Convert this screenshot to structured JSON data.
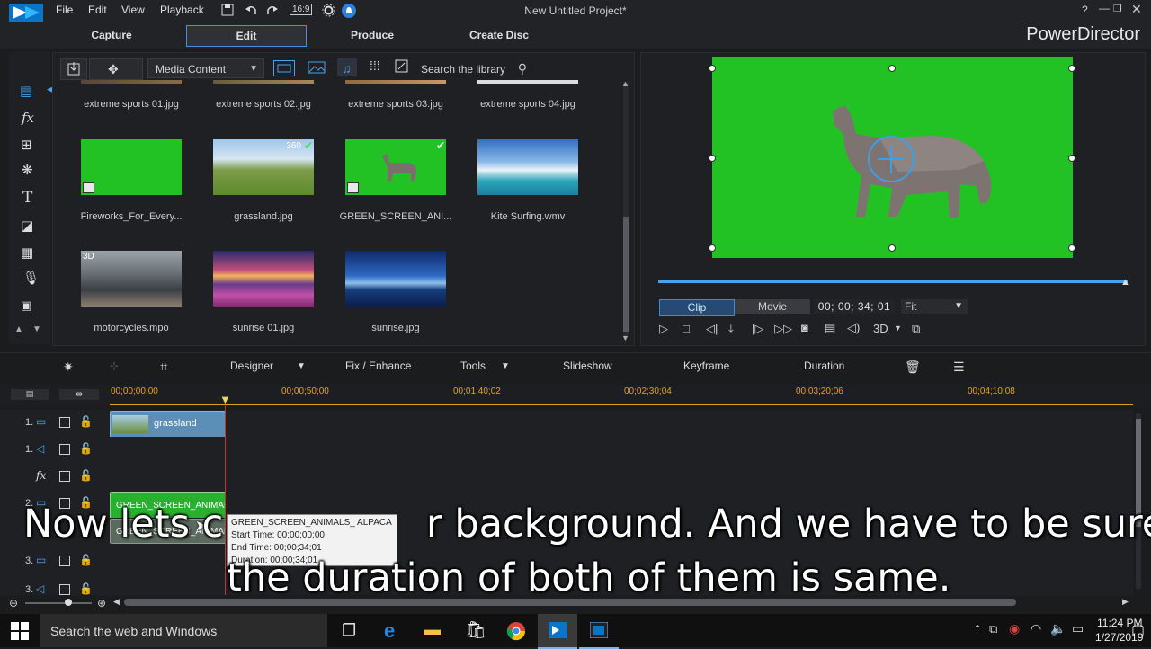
{
  "titlebar": {
    "menus": [
      "File",
      "Edit",
      "View",
      "Playback"
    ],
    "aspect": "16:9",
    "project_title": "New Untitled Project*"
  },
  "modes": [
    "Capture",
    "Edit",
    "Produce",
    "Create Disc"
  ],
  "brand": "PowerDirector",
  "library": {
    "dropdown": "Media Content",
    "search_placeholder": "Search the library",
    "items": [
      {
        "label": "extreme sports 01.jpg"
      },
      {
        "label": "extreme sports 02.jpg"
      },
      {
        "label": "extreme sports 03.jpg"
      },
      {
        "label": "extreme sports 04.jpg"
      },
      {
        "label": "Fireworks_For_Every..."
      },
      {
        "label": "grassland.jpg",
        "badge": "360"
      },
      {
        "label": "GREEN_SCREEN_ANI..."
      },
      {
        "label": "Kite Surfing.wmv"
      },
      {
        "label": "motorcycles.mpo",
        "badge": "3D"
      },
      {
        "label": "sunrise 01.jpg"
      },
      {
        "label": "sunrise.jpg"
      }
    ]
  },
  "preview": {
    "clip_label": "Clip",
    "movie_label": "Movie",
    "timecode": "00; 00; 34; 01",
    "fit": "Fit",
    "three_d": "3D"
  },
  "timeline_tools": {
    "designer": "Designer",
    "fix": "Fix / Enhance",
    "tools": "Tools",
    "slideshow": "Slideshow",
    "keyframe": "Keyframe",
    "duration": "Duration"
  },
  "ruler": [
    "00;00;00;00",
    "00;00;50;00",
    "00;01;40;02",
    "00;02;30;04",
    "00;03;20;06",
    "00;04;10;08"
  ],
  "tracks": [
    {
      "num": "1.",
      "clip": "grassland"
    },
    {
      "num": "1.",
      "clip": ""
    },
    {
      "num": "",
      "clip": ""
    },
    {
      "num": "2.",
      "clip": "GREEN_SCREEN_ANIMAL"
    },
    {
      "num": "2.",
      "clip": "GREEN_SCREEN_ANIMAL"
    },
    {
      "num": "3.",
      "clip": ""
    },
    {
      "num": "3.",
      "clip": ""
    }
  ],
  "tooltip": {
    "name": "GREEN_SCREEN_ANIMALS_ ALPACA",
    "start": "Start Time: 00;00;00;00",
    "end": "End Time: 00;00;34;01",
    "duration": "Duration: 00;00;34;01"
  },
  "subtitle": {
    "line1_a": "Now lets c",
    "line1_b": "r background. And we have to be sure",
    "line2": "the duration of both of them is same."
  },
  "taskbar": {
    "search": "Search the web and Windows",
    "time": "11:24 PM",
    "date": "1/27/2019"
  }
}
